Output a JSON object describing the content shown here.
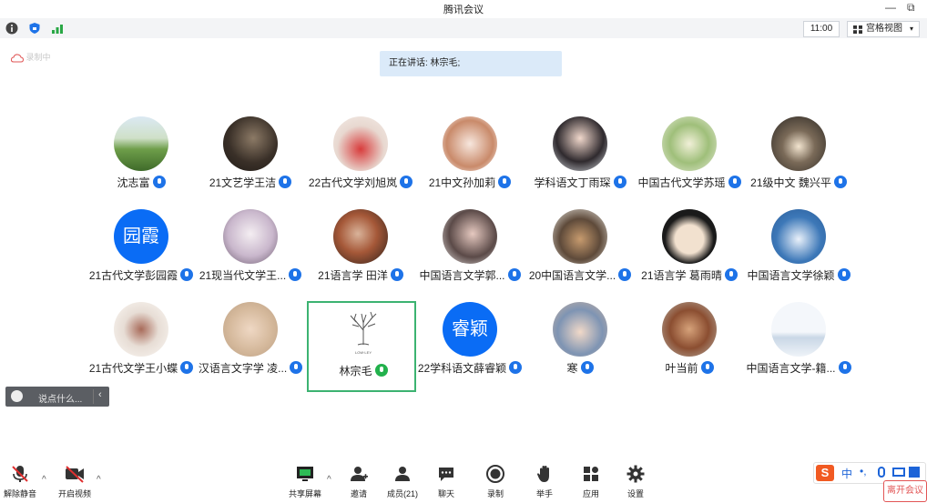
{
  "window": {
    "title": "腾讯会议",
    "minimize": "—",
    "restore": "⧉"
  },
  "toolbar": {
    "time": "11:00",
    "view_label": "宫格视图",
    "view_caret": "▾"
  },
  "recording": {
    "label": "录制中"
  },
  "speaking": {
    "text": "正在讲话: 林宗毛;"
  },
  "participants": [
    {
      "name": "沈志富",
      "avatar": "landscape"
    },
    {
      "name": "21文艺学王洁",
      "avatar": "photo-dark"
    },
    {
      "name": "22古代文学刘旭岚",
      "avatar": "child-red"
    },
    {
      "name": "21中文孙加莉",
      "avatar": "cartoon-girl"
    },
    {
      "name": "学科语文丁雨琛",
      "avatar": "selfie"
    },
    {
      "name": "中国古代文学苏瑶",
      "avatar": "plant"
    },
    {
      "name": "21级中文 魏兴平",
      "avatar": "cat-dark"
    },
    {
      "name": "21古代文学彭园霞",
      "avatar": "text",
      "avatar_text": "园霞"
    },
    {
      "name": "21现当代文学王...",
      "avatar": "anime"
    },
    {
      "name": "21语言学 田洋",
      "avatar": "portrait-warm"
    },
    {
      "name": "中国语言文学郭...",
      "avatar": "portrait-girl"
    },
    {
      "name": "20中国语言文学...",
      "avatar": "bear-desk"
    },
    {
      "name": "21语言学 葛雨晴",
      "avatar": "cartoon-face"
    },
    {
      "name": "中国语言文学徐颖",
      "avatar": "blue-scene"
    },
    {
      "name": "21古代文学王小蝶",
      "avatar": "ink-painting"
    },
    {
      "name": "汉语言文字学 凌...",
      "avatar": "plush-bear"
    },
    {
      "name": "林宗毛",
      "avatar": "tree-logo",
      "avatar_caption": "LOW·LEY"
    },
    {
      "name": "22学科语文薛睿颖",
      "avatar": "text",
      "avatar_text": "睿颖"
    },
    {
      "name": "寒",
      "avatar": "street"
    },
    {
      "name": "叶当前",
      "avatar": "poster"
    },
    {
      "name": "中国语言文学-籍...",
      "avatar": "pale-sea"
    }
  ],
  "chat": {
    "placeholder": "说点什么...",
    "collapse": "‹"
  },
  "bottombar": {
    "unmute": "解除静音",
    "start_video": "开启视频",
    "share_screen": "共享屏幕",
    "invite": "邀请",
    "members": "成员(21)",
    "chat": "聊天",
    "record": "录制",
    "raise_hand": "举手",
    "apps": "应用",
    "settings": "设置"
  },
  "ime": {
    "logo": "S",
    "lang": "中",
    "punct": "•,",
    "icons": [
      "mic-icon",
      "keyboard-icon",
      "skin-icon"
    ]
  },
  "leave": {
    "label": "离开会议"
  },
  "colors": {
    "accent": "#0a6cf5",
    "active_border": "#3cb371",
    "speaking_bg": "#dbeaf9",
    "leave": "#e25555"
  }
}
